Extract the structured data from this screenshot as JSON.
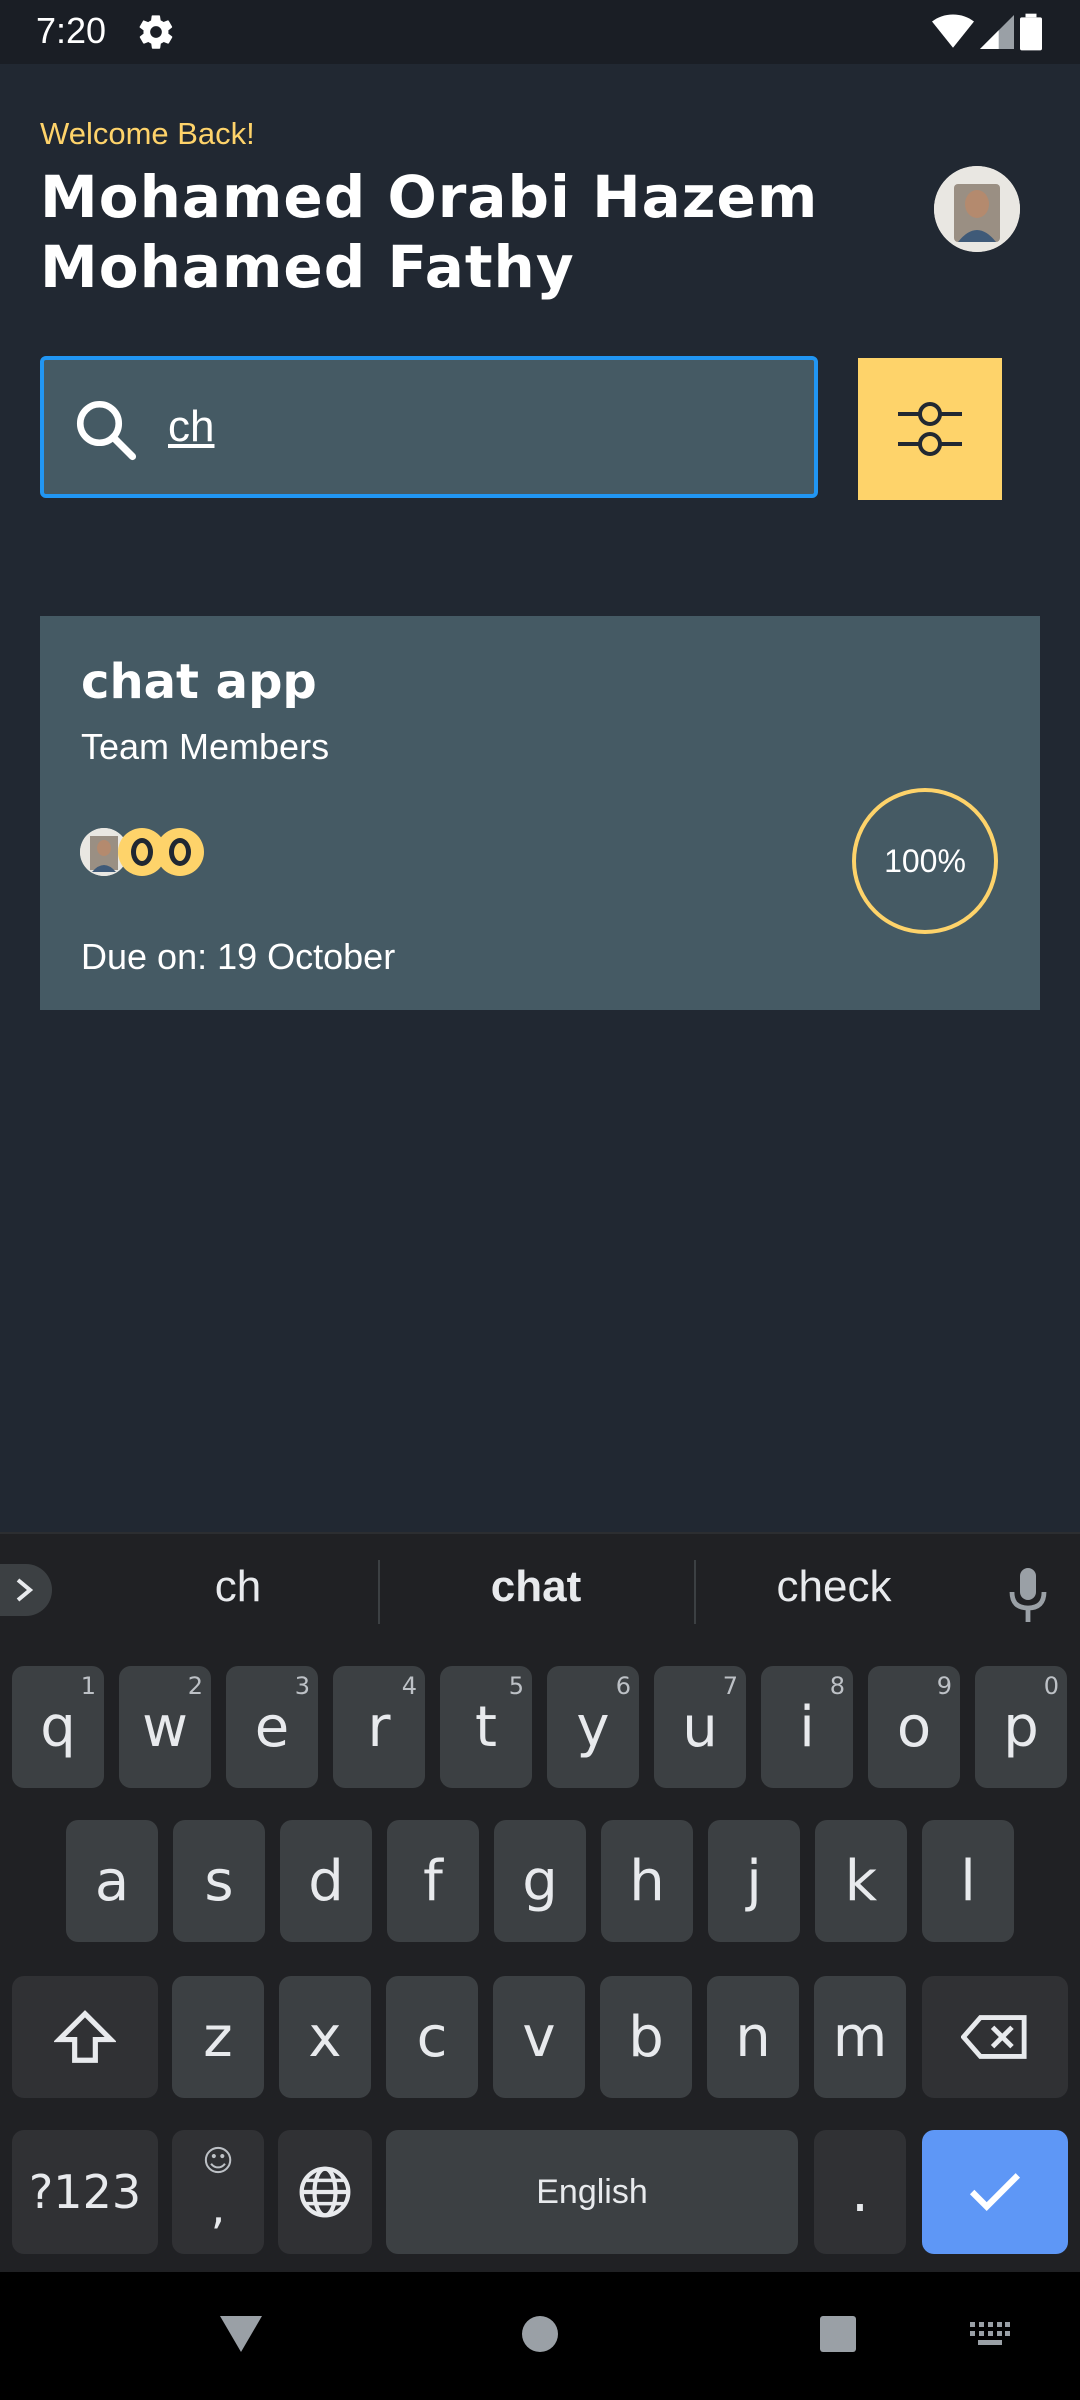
{
  "status": {
    "time": "7:20"
  },
  "header": {
    "welcome": "Welcome Back!",
    "username": "Mohamed Orabi Hazem Mohamed Fathy"
  },
  "search": {
    "value": "ch"
  },
  "task": {
    "title": "chat app",
    "subtitle": "Team Members",
    "due": "Due on: 19 October",
    "progress_label": "100%",
    "progress": 1.0
  },
  "keyboard": {
    "suggestions": [
      "ch",
      "chat",
      "check"
    ],
    "row1": [
      {
        "k": "q",
        "n": "1"
      },
      {
        "k": "w",
        "n": "2"
      },
      {
        "k": "e",
        "n": "3"
      },
      {
        "k": "r",
        "n": "4"
      },
      {
        "k": "t",
        "n": "5"
      },
      {
        "k": "y",
        "n": "6"
      },
      {
        "k": "u",
        "n": "7"
      },
      {
        "k": "i",
        "n": "8"
      },
      {
        "k": "o",
        "n": "9"
      },
      {
        "k": "p",
        "n": "0"
      }
    ],
    "row2": [
      "a",
      "s",
      "d",
      "f",
      "g",
      "h",
      "j",
      "k",
      "l"
    ],
    "row3": [
      "z",
      "x",
      "c",
      "v",
      "b",
      "n",
      "m"
    ],
    "symbols_label": "?123",
    "comma_label": ",",
    "space_label": "English",
    "period_label": "."
  },
  "colors": {
    "accent": "#fed36a",
    "background": "#212832",
    "card": "#455a64",
    "focus": "#2196f3"
  }
}
